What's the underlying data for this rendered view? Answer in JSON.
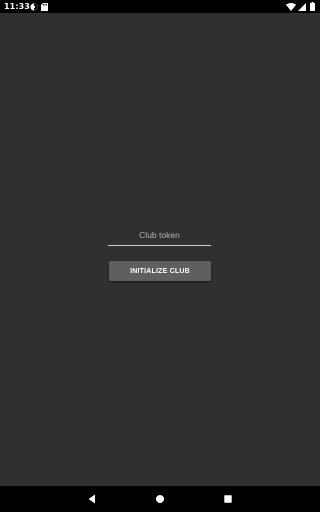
{
  "status_bar": {
    "time": "11:33",
    "left_icons": [
      "media-icon",
      "sd-card-icon"
    ],
    "right_icons": [
      "wifi-icon",
      "signal-icon",
      "battery-icon"
    ]
  },
  "form": {
    "token_placeholder": "Club token",
    "token_value": "",
    "init_button_label": "INITIALIZE CLUB"
  },
  "nav_bar": {
    "buttons": [
      "back-icon",
      "home-icon",
      "recents-icon"
    ]
  },
  "colors": {
    "background": "#303030",
    "bars": "#000000",
    "button": "#5f5f5f",
    "text": "#ffffff"
  }
}
